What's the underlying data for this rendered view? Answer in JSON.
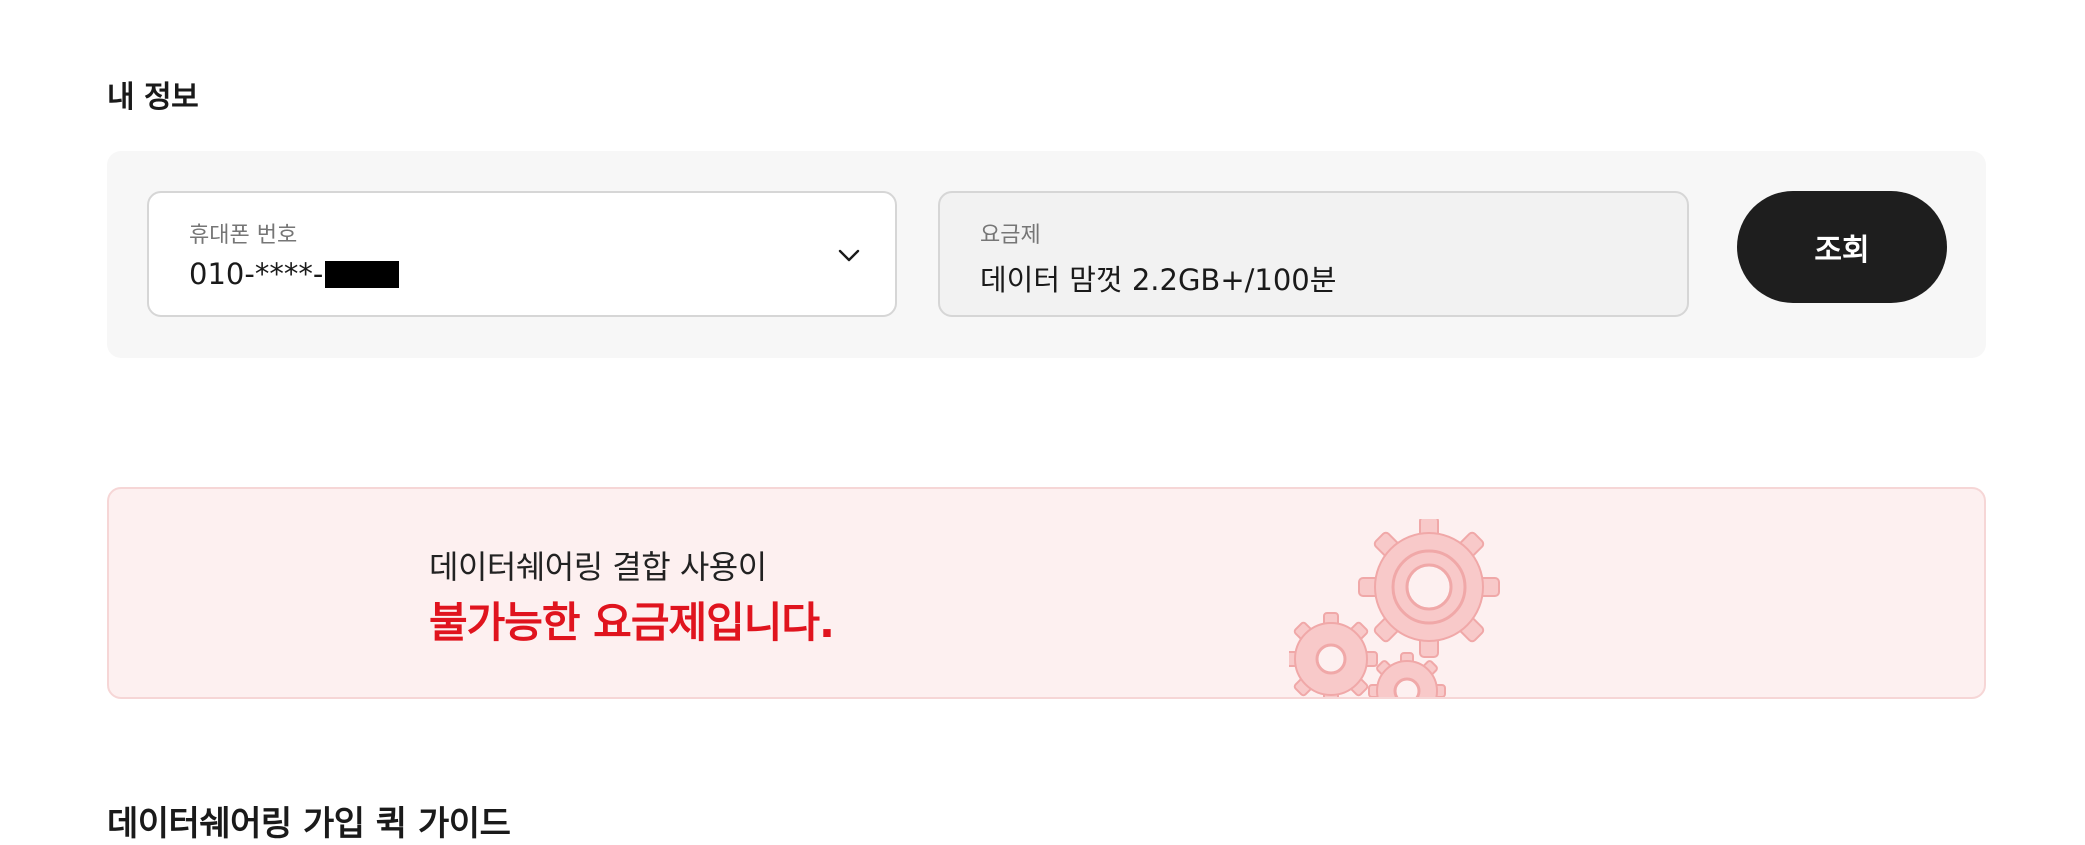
{
  "my_info": {
    "title": "내 정보",
    "phone_field": {
      "label": "휴대폰 번호",
      "value": "010-****-"
    },
    "plan_field": {
      "label": "요금제",
      "value": "데이터 맘껏 2.2GB+/100분"
    },
    "query_button": "조회"
  },
  "notice": {
    "line1": "데이터쉐어링 결합 사용이",
    "line2": "불가능한 요금제입니다."
  },
  "guide": {
    "title": "데이터쉐어링 가입 퀵 가이드"
  },
  "colors": {
    "accent_red": "#e0141e",
    "button_dark": "#1e1e1e",
    "notice_bg": "#fdf0f0"
  }
}
